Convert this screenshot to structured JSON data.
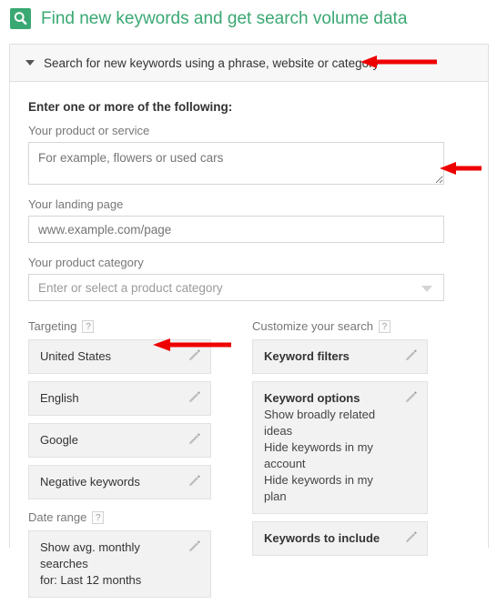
{
  "header": {
    "icon": "keyword-planner-search-icon",
    "title": "Find new keywords and get search volume data",
    "icon_color": "#3aa873",
    "title_color": "#3aa873"
  },
  "panel": {
    "collapse_icon": "chevron-down-icon",
    "bar_label": "Search for new keywords using a phrase, website or category"
  },
  "form": {
    "lead": "Enter one or more of the following:",
    "product_or_service": {
      "label": "Your product or service",
      "placeholder": "For example, flowers or used cars",
      "value": ""
    },
    "landing_page": {
      "label": "Your landing page",
      "placeholder": "www.example.com/page",
      "value": ""
    },
    "product_category": {
      "label": "Your product category",
      "placeholder": "Enter or select a product category",
      "value": "",
      "caret_icon": "caret-down-icon"
    }
  },
  "targeting": {
    "heading": "Targeting",
    "help_icon": "help-question-icon",
    "help_label": "?",
    "items": [
      {
        "label": "United States",
        "edit_icon": "pencil-icon"
      },
      {
        "label": "English",
        "edit_icon": "pencil-icon"
      },
      {
        "label": "Google",
        "edit_icon": "pencil-icon"
      },
      {
        "label": "Negative keywords",
        "edit_icon": "pencil-icon"
      }
    ]
  },
  "date_range": {
    "heading": "Date range",
    "help_icon": "help-question-icon",
    "help_label": "?",
    "value_line1": "Show avg. monthly searches",
    "value_line2": "for: Last 12 months",
    "edit_icon": "pencil-icon"
  },
  "customize": {
    "heading": "Customize your search",
    "help_icon": "help-question-icon",
    "help_label": "?",
    "keyword_filters": {
      "title": "Keyword filters",
      "edit_icon": "pencil-icon"
    },
    "keyword_options": {
      "title": "Keyword options",
      "lines": [
        "Show broadly related ideas",
        "Hide keywords in my account",
        "Hide keywords in my plan"
      ],
      "edit_icon": "pencil-icon"
    },
    "keywords_to_include": {
      "title": "Keywords to include",
      "edit_icon": "pencil-icon"
    }
  },
  "annotations": {
    "color": "#ee0000",
    "arrows": [
      {
        "name": "arrow-pointing-to-panel-bar"
      },
      {
        "name": "arrow-pointing-to-product-service-field"
      },
      {
        "name": "arrow-pointing-to-united-states-target"
      }
    ]
  }
}
